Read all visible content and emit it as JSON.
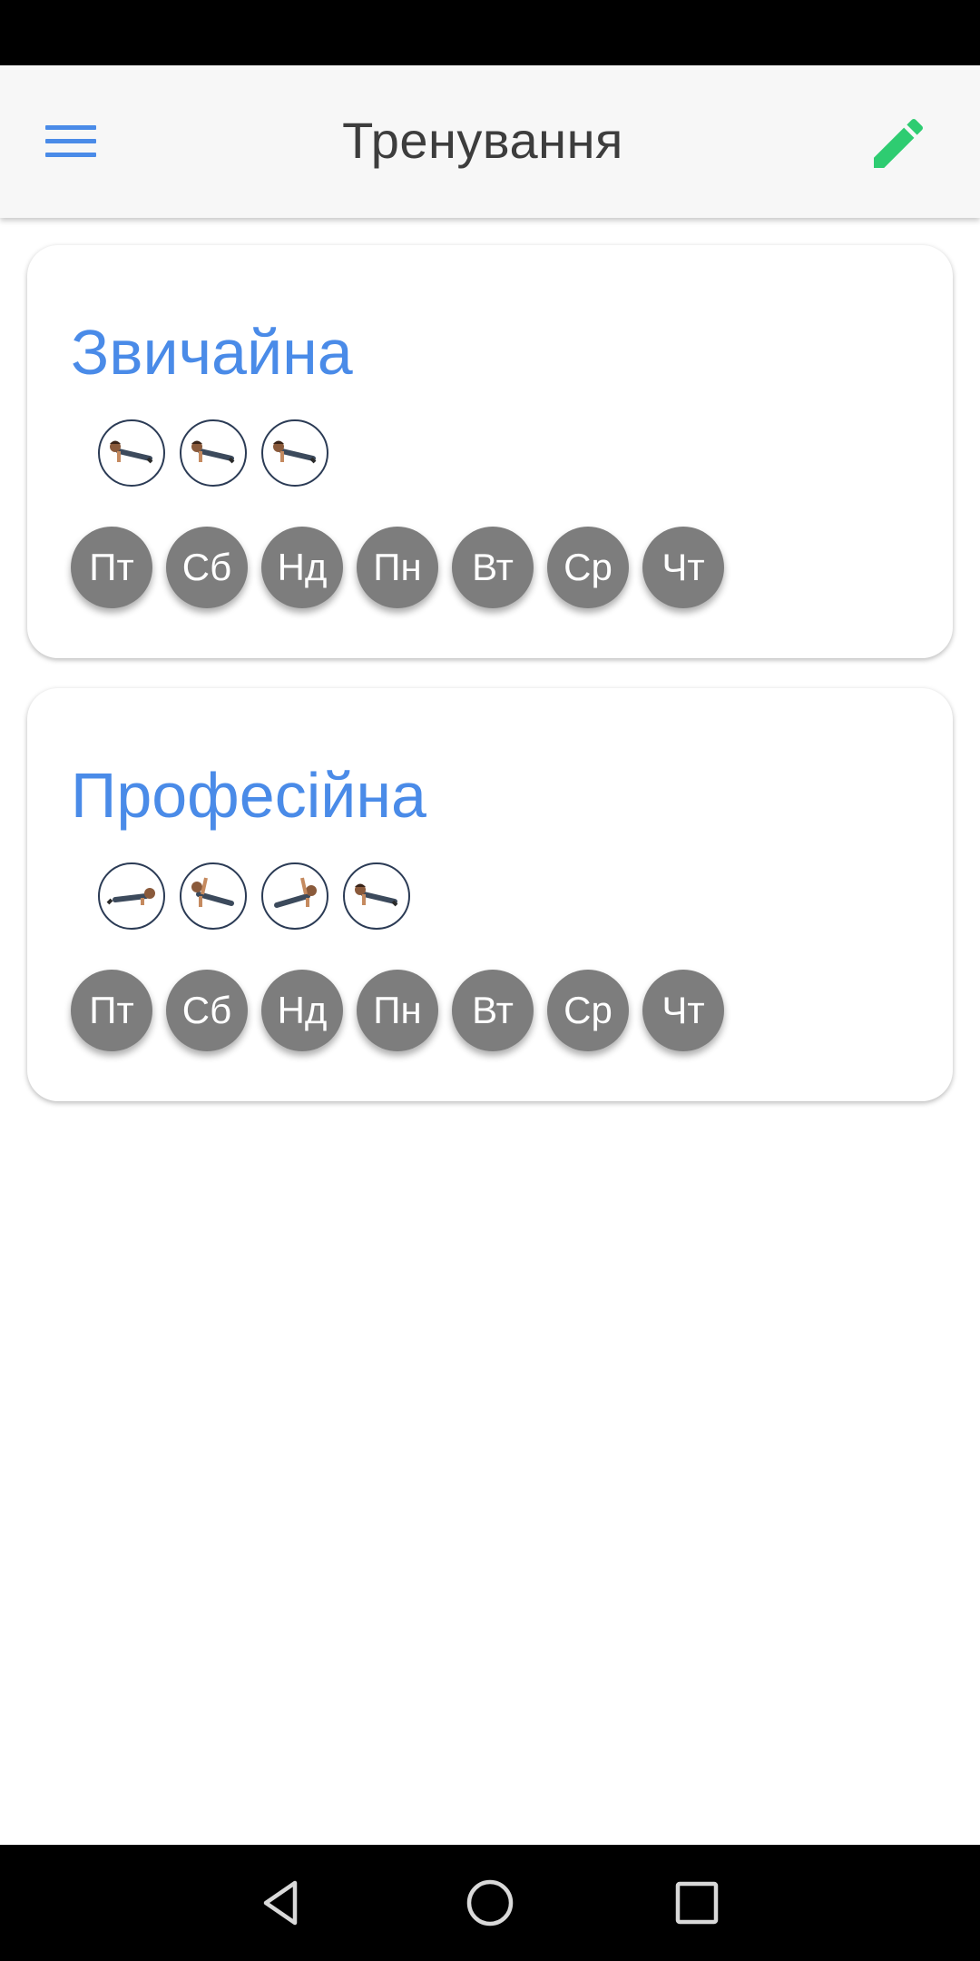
{
  "app_bar": {
    "title": "Тренування",
    "menu_icon": "menu-icon",
    "edit_icon": "pencil-icon",
    "edit_color": "#2ecc71",
    "menu_color": "#4a8be8"
  },
  "workouts": [
    {
      "title": "Звичайна",
      "exercise_icons": [
        "pushup-icon",
        "pushup-icon",
        "pushup-icon"
      ],
      "days": [
        "Пт",
        "Сб",
        "Нд",
        "Пн",
        "Вт",
        "Ср",
        "Чт"
      ]
    },
    {
      "title": "Професійна",
      "exercise_icons": [
        "plank-icon",
        "side-plank-icon",
        "side-plank-icon",
        "pushup-icon"
      ],
      "days": [
        "Пт",
        "Сб",
        "Нд",
        "Пн",
        "Вт",
        "Ср",
        "Чт"
      ]
    }
  ],
  "nav_bar": {
    "back_icon": "back-icon",
    "home_icon": "home-icon",
    "recents_icon": "recents-icon"
  },
  "colors": {
    "accent": "#4a8be8",
    "day_badge": "#7d7d7d",
    "title_text": "#3d3d3d"
  }
}
